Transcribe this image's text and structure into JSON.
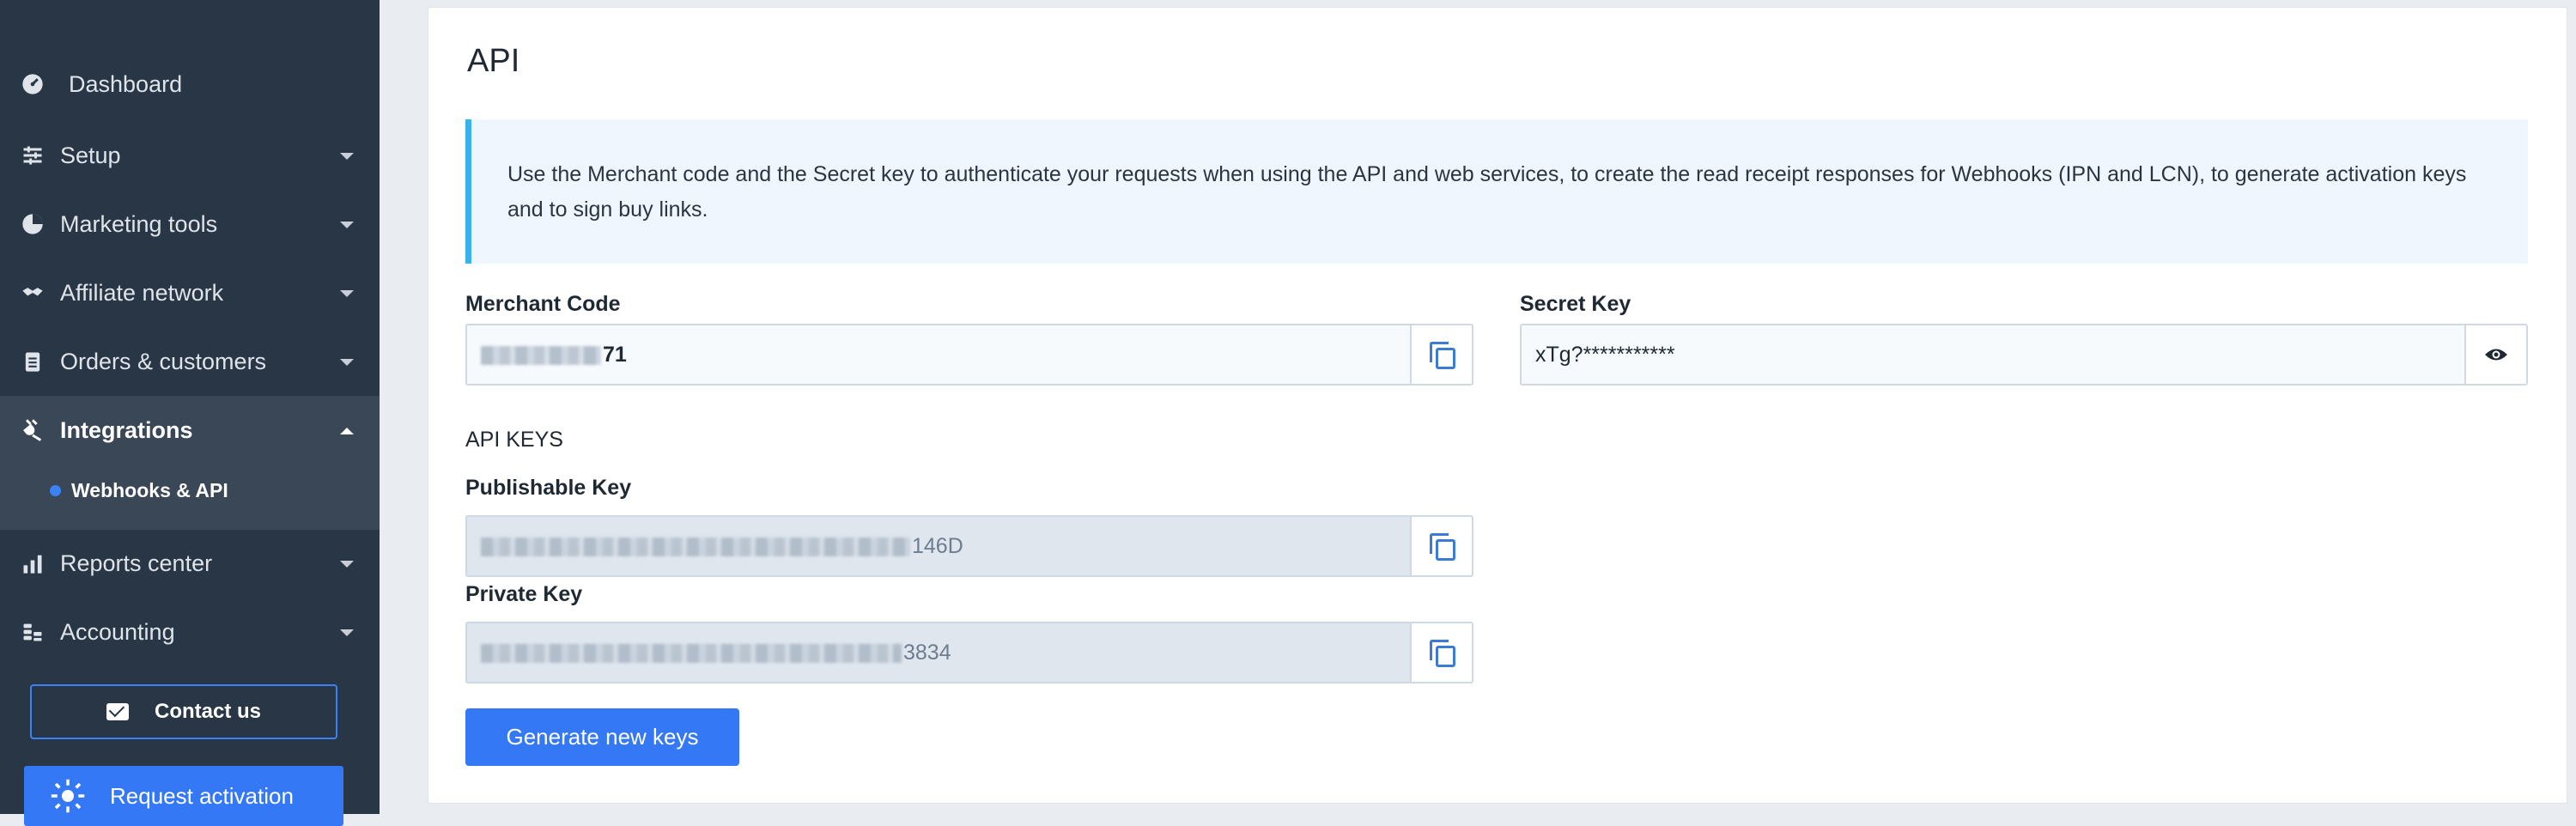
{
  "sidebar": {
    "items": [
      {
        "label": "Dashboard",
        "icon": "dashboard-icon"
      },
      {
        "label": "Setup",
        "icon": "sliders-icon"
      },
      {
        "label": "Marketing tools",
        "icon": "pie-chart-icon"
      },
      {
        "label": "Affiliate network",
        "icon": "handshake-icon"
      },
      {
        "label": "Orders & customers",
        "icon": "clipboard-icon"
      },
      {
        "label": "Integrations",
        "icon": "plug-icon"
      },
      {
        "label": "Reports center",
        "icon": "bar-chart-icon"
      },
      {
        "label": "Accounting",
        "icon": "coins-icon"
      }
    ],
    "active_sub_item": "Webhooks & API",
    "contact_label": "Contact us",
    "activation_label": "Request activation"
  },
  "main": {
    "title": "API",
    "info_text": "Use the Merchant code and the Secret key to authenticate your requests when using the API and web services, to create the read receipt responses for Webhooks (IPN and LCN), to generate activation keys and to sign buy links.",
    "merchant_code": {
      "label": "Merchant Code",
      "value_visible": "71"
    },
    "secret_key": {
      "label": "Secret Key",
      "value": "xTg?***********"
    },
    "api_keys_heading": "API KEYS",
    "publishable_key": {
      "label": "Publishable Key",
      "value_visible": "146D"
    },
    "private_key": {
      "label": "Private Key",
      "value_visible": "3834"
    },
    "generate_label": "Generate new keys"
  },
  "colors": {
    "sidebar_bg": "#283645",
    "accent": "#3478f6",
    "info_border": "#38b2ec"
  }
}
